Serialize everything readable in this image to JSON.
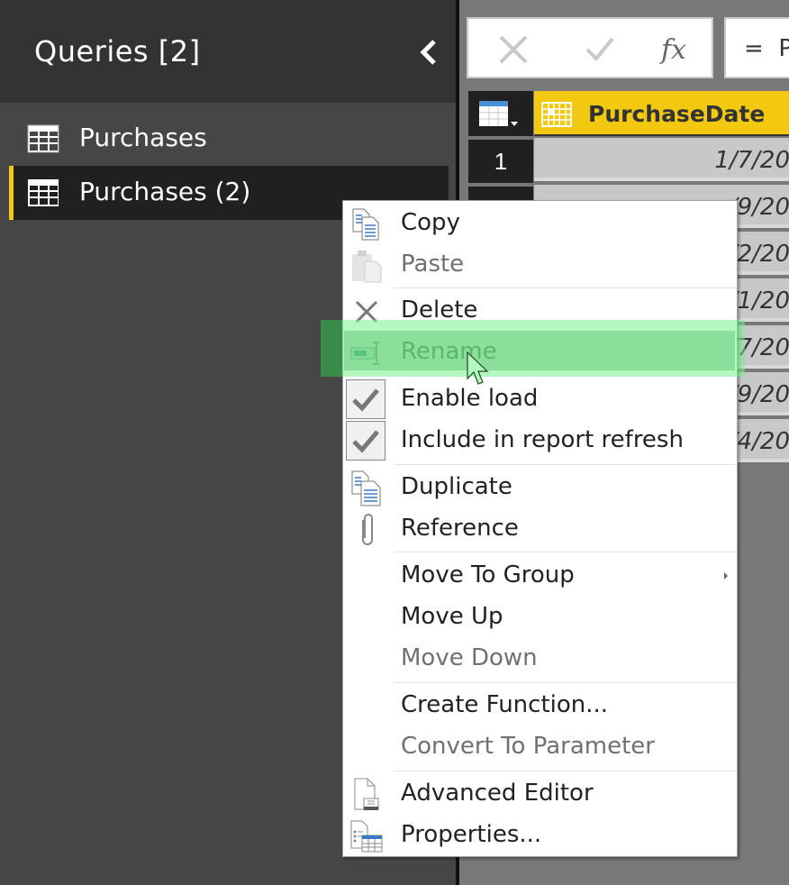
{
  "queries_pane": {
    "title": "Queries [2]",
    "collapse_icon": "chevron-left-icon",
    "items": [
      {
        "label": "Purchases",
        "icon": "table-icon",
        "selected": false
      },
      {
        "label": "Purchases (2)",
        "icon": "table-icon",
        "selected": true
      }
    ],
    "accent_color": "#f2c811"
  },
  "formula_bar": {
    "cancel_icon": "close-icon",
    "commit_icon": "checkmark-icon",
    "fx_label": "fx",
    "formula_text": "=  P"
  },
  "grid": {
    "column_header": "PurchaseDate",
    "column_type_icon": "date-icon",
    "rows": [
      {
        "num": "1",
        "value": "1/7/20"
      },
      {
        "num": "",
        "value": "/9/20"
      },
      {
        "num": "",
        "value": "/2/20"
      },
      {
        "num": "",
        "value": "/1/20"
      },
      {
        "num": "",
        "value": "/7/20"
      },
      {
        "num": "",
        "value": "/9/20"
      },
      {
        "num": "",
        "value": "/4/20"
      }
    ]
  },
  "context_menu": {
    "items": {
      "copy": {
        "label": "Copy",
        "icon": "copy-icon",
        "enabled": true
      },
      "paste": {
        "label": "Paste",
        "icon": "paste-icon",
        "enabled": false
      },
      "delete": {
        "label": "Delete",
        "icon": "delete-icon",
        "enabled": true
      },
      "rename": {
        "label": "Rename",
        "icon": "rename-icon",
        "enabled": true,
        "highlighted": true
      },
      "enable_load": {
        "label": "Enable load",
        "icon": "checkbox-checked-icon",
        "checked": true
      },
      "include_refresh": {
        "label": "Include in report refresh",
        "icon": "checkbox-checked-icon",
        "checked": true
      },
      "duplicate": {
        "label": "Duplicate",
        "icon": "duplicate-icon",
        "enabled": true
      },
      "reference": {
        "label": "Reference",
        "icon": "paperclip-icon",
        "enabled": true
      },
      "move_to_group": {
        "label": "Move To Group",
        "has_submenu": true,
        "enabled": true
      },
      "move_up": {
        "label": "Move Up",
        "enabled": true
      },
      "move_down": {
        "label": "Move Down",
        "enabled": false
      },
      "create_function": {
        "label": "Create Function...",
        "enabled": true
      },
      "convert_param": {
        "label": "Convert To Parameter",
        "enabled": false
      },
      "advanced_editor": {
        "label": "Advanced Editor",
        "icon": "advanced-editor-icon",
        "enabled": true
      },
      "properties": {
        "label": "Properties...",
        "icon": "properties-icon",
        "enabled": true
      }
    }
  }
}
